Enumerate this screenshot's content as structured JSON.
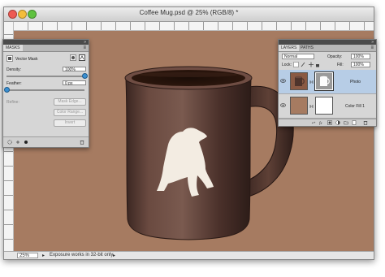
{
  "window": {
    "title": "Coffee Mug.psd @ 25% (RGB/8) *"
  },
  "colors": {
    "canvas": "#a67b61",
    "mug": "#5a3a30",
    "bear": "#f3ece2",
    "accent": "#3a8fd1",
    "selected_layer": "#b7cde6"
  },
  "status_bar": {
    "zoom": "25%",
    "message": "Exposure works in 32-bit only"
  },
  "masks_panel": {
    "tab": "MASKS",
    "mask_type": "Vector Mask",
    "density_label": "Density:",
    "density_value": "100%",
    "density_level": 1.0,
    "feather_label": "Feather:",
    "feather_value": "0 px",
    "feather_level": 0.0,
    "refine_label": "Refine:",
    "mask_edge_button": "Mask Edge...",
    "color_range_button": "Color Range...",
    "invert_button": "Invert",
    "icons": [
      "pixel-mask-icon",
      "vector-mask-icon",
      "load-selection-icon",
      "apply-mask-icon",
      "disable-mask-icon",
      "delete-mask-icon"
    ]
  },
  "layers_panel": {
    "tabs": [
      "LAYERS",
      "PATHS"
    ],
    "blend_mode": "Normal",
    "opacity_label": "Opacity:",
    "opacity_value": "100%",
    "lock_label": "Lock:",
    "fill_label": "Fill:",
    "fill_value": "100%",
    "layers": [
      {
        "name": "Photo",
        "selected": true
      },
      {
        "name": "Color Fill 1",
        "selected": false
      }
    ],
    "icons": [
      "link-icon",
      "fx-icon",
      "add-mask-icon",
      "adjustment-icon",
      "group-icon",
      "new-layer-icon",
      "trash-icon"
    ]
  }
}
